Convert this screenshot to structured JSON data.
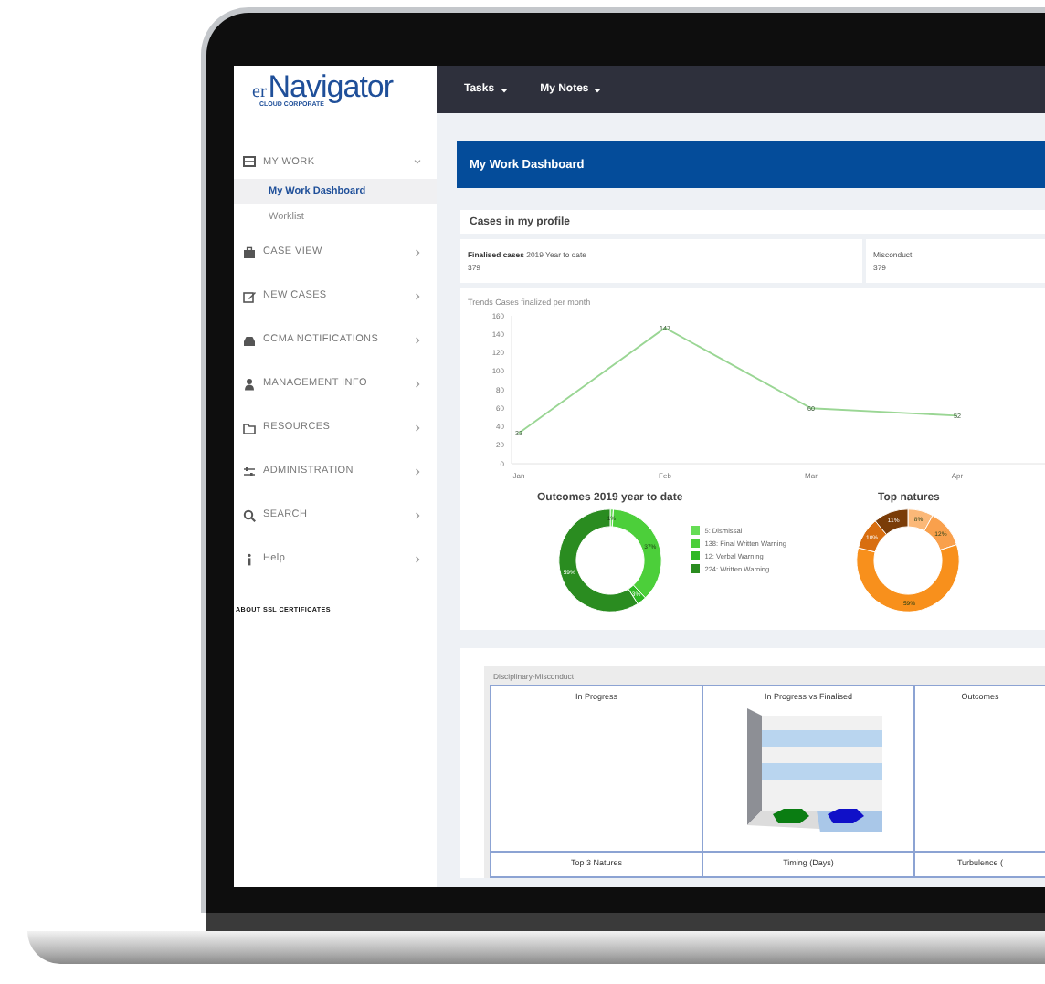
{
  "logo": {
    "prefix": "er",
    "name": "Navigator",
    "tagline": "CLOUD CORPORATE"
  },
  "top_menu": [
    {
      "label": "Tasks"
    },
    {
      "label": "My Notes"
    }
  ],
  "sidebar": {
    "items": [
      {
        "label": "MY WORK",
        "expanded": true,
        "children": [
          {
            "label": "My Work Dashboard",
            "selected": true
          },
          {
            "label": "Worklist",
            "selected": false
          }
        ]
      },
      {
        "label": "CASE VIEW",
        "expanded": false
      },
      {
        "label": "NEW CASES",
        "expanded": false
      },
      {
        "label": "CCMA NOTIFICATIONS",
        "expanded": false
      },
      {
        "label": "MANAGEMENT INFO",
        "expanded": false
      },
      {
        "label": "RESOURCES",
        "expanded": false
      },
      {
        "label": "ADMINISTRATION",
        "expanded": false
      },
      {
        "label": "SEARCH",
        "expanded": false
      },
      {
        "label": "Help",
        "expanded": false
      }
    ],
    "footer_link": "ABOUT SSL CERTIFICATES"
  },
  "page_title": "My Work Dashboard",
  "section_title": "Cases in my profile",
  "stats": [
    {
      "label": "**Finalised cases** 2019 Year to date",
      "value": "379"
    },
    {
      "label": "Misconduct",
      "value": "379"
    }
  ],
  "trend_chart": {
    "chart_data": {
      "type": "line",
      "title": "Trends Cases finalized per month",
      "categories": [
        "Jan",
        "Feb",
        "Mar",
        "Apr"
      ],
      "series": [
        {
          "color": "#9ad694",
          "values": [
            33,
            147,
            60,
            52
          ]
        }
      ],
      "ylim": [
        0,
        160
      ],
      "yticks": [
        0,
        20,
        40,
        60,
        80,
        100,
        120,
        140,
        160
      ],
      "data_labels": true
    }
  },
  "outcomes_chart": {
    "chart_data": {
      "type": "donut",
      "title": "Outcomes 2019 year to date",
      "categories": [
        "5: Dismissal",
        "138: Final Written Warning",
        "12: Verbal Warning",
        "224: Written Warning"
      ],
      "values": [
        1,
        37,
        3,
        59
      ],
      "colors": [
        "#66dd55",
        "#4ccf3a",
        "#2fb824",
        "#2a8c20"
      ],
      "value_labels": [
        "1%",
        "37%",
        "3%",
        "59%"
      ]
    }
  },
  "natures_chart": {
    "chart_data": {
      "type": "donut",
      "title": "Top natures",
      "values": [
        8,
        12,
        59,
        10,
        11
      ],
      "colors": [
        "#fbb878",
        "#f9a04c",
        "#f8901c",
        "#d86e10",
        "#7a3c08"
      ],
      "value_labels": [
        "8%",
        "12%",
        "59%",
        "10%",
        "11%"
      ]
    }
  },
  "panel": {
    "title": "Disciplinary-Misconduct",
    "cells": [
      {
        "title": "In Progress",
        "kind": "empty"
      },
      {
        "title": "In Progress vs Finalised",
        "kind": "chart3d"
      },
      {
        "title": "Outcomes",
        "kind": "empty"
      },
      {
        "title": "Top 3 Natures",
        "kind": "empty"
      },
      {
        "title": "Timing (Days)",
        "kind": "empty"
      },
      {
        "title": "Turbulence (",
        "kind": "empty"
      }
    ]
  }
}
